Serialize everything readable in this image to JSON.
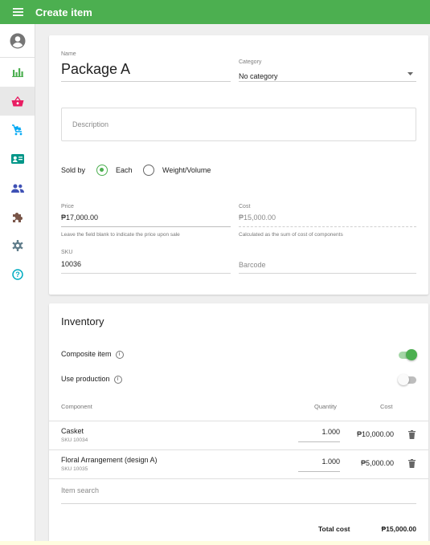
{
  "header": {
    "title": "Create item",
    "menu_icon": "menu-icon"
  },
  "sidebar": {
    "items": [
      {
        "name": "account",
        "icon": "account-circle-icon",
        "color": "#757575"
      },
      {
        "name": "reports",
        "icon": "bar-chart-icon",
        "color": "#4caf50"
      },
      {
        "name": "items",
        "icon": "basket-icon",
        "color": "#e91e63",
        "active": true
      },
      {
        "name": "inventory",
        "icon": "cart-icon",
        "color": "#03a9f4"
      },
      {
        "name": "employees",
        "icon": "badge-icon",
        "color": "#009688"
      },
      {
        "name": "customers",
        "icon": "people-icon",
        "color": "#3f51b5"
      },
      {
        "name": "integrations",
        "icon": "puzzle-icon",
        "color": "#795548"
      },
      {
        "name": "settings",
        "icon": "gear-icon",
        "color": "#607d8b"
      },
      {
        "name": "help",
        "icon": "help-icon",
        "color": "#00acc1"
      }
    ]
  },
  "item": {
    "name_label": "Name",
    "name_value": "Package A",
    "category_label": "Category",
    "category_value": "No category",
    "description_placeholder": "Description",
    "sold_by_label": "Sold by",
    "sold_by_options": [
      "Each",
      "Weight/Volume"
    ],
    "sold_by_selected": "Each",
    "price_label": "Price",
    "price_value": "₱17,000.00",
    "price_hint": "Leave the field blank to indicate the price upon sale",
    "cost_label": "Cost",
    "cost_value": "₱15,000.00",
    "cost_hint": "Calculated as the sum of cost of components",
    "sku_label": "SKU",
    "sku_value": "10036",
    "barcode_placeholder": "Barcode"
  },
  "inventory": {
    "title": "Inventory",
    "composite_label": "Composite item",
    "composite_on": true,
    "production_label": "Use production",
    "production_on": false,
    "columns": {
      "component": "Component",
      "quantity": "Quantity",
      "cost": "Cost"
    },
    "rows": [
      {
        "name": "Casket",
        "sku": "SKU 10034",
        "quantity": "1.000",
        "cost": "₱10,000.00"
      },
      {
        "name": "Floral Arrangement (design A)",
        "sku": "SKU 10035",
        "quantity": "1.000",
        "cost": "₱5,000.00"
      }
    ],
    "search_placeholder": "Item search",
    "total_label": "Total cost",
    "total_value": "₱15,000.00"
  },
  "colors": {
    "accent": "#4caf50",
    "appbar": "#4caf50"
  }
}
